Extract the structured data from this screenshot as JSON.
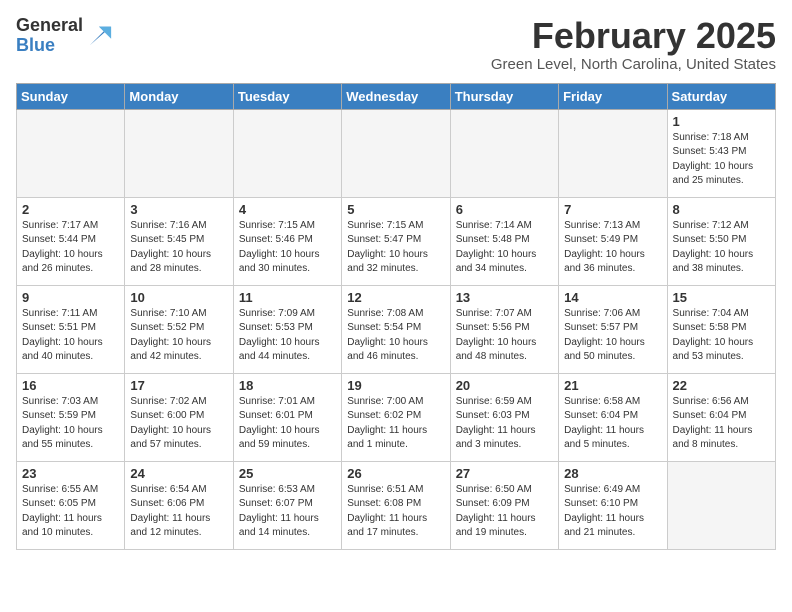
{
  "header": {
    "logo_general": "General",
    "logo_blue": "Blue",
    "title": "February 2025",
    "subtitle": "Green Level, North Carolina, United States"
  },
  "days_of_week": [
    "Sunday",
    "Monday",
    "Tuesday",
    "Wednesday",
    "Thursday",
    "Friday",
    "Saturday"
  ],
  "weeks": [
    [
      {
        "num": "",
        "info": "",
        "empty": true
      },
      {
        "num": "",
        "info": "",
        "empty": true
      },
      {
        "num": "",
        "info": "",
        "empty": true
      },
      {
        "num": "",
        "info": "",
        "empty": true
      },
      {
        "num": "",
        "info": "",
        "empty": true
      },
      {
        "num": "",
        "info": "",
        "empty": true
      },
      {
        "num": "1",
        "info": "Sunrise: 7:18 AM\nSunset: 5:43 PM\nDaylight: 10 hours\nand 25 minutes.",
        "empty": false
      }
    ],
    [
      {
        "num": "2",
        "info": "Sunrise: 7:17 AM\nSunset: 5:44 PM\nDaylight: 10 hours\nand 26 minutes.",
        "empty": false
      },
      {
        "num": "3",
        "info": "Sunrise: 7:16 AM\nSunset: 5:45 PM\nDaylight: 10 hours\nand 28 minutes.",
        "empty": false
      },
      {
        "num": "4",
        "info": "Sunrise: 7:15 AM\nSunset: 5:46 PM\nDaylight: 10 hours\nand 30 minutes.",
        "empty": false
      },
      {
        "num": "5",
        "info": "Sunrise: 7:15 AM\nSunset: 5:47 PM\nDaylight: 10 hours\nand 32 minutes.",
        "empty": false
      },
      {
        "num": "6",
        "info": "Sunrise: 7:14 AM\nSunset: 5:48 PM\nDaylight: 10 hours\nand 34 minutes.",
        "empty": false
      },
      {
        "num": "7",
        "info": "Sunrise: 7:13 AM\nSunset: 5:49 PM\nDaylight: 10 hours\nand 36 minutes.",
        "empty": false
      },
      {
        "num": "8",
        "info": "Sunrise: 7:12 AM\nSunset: 5:50 PM\nDaylight: 10 hours\nand 38 minutes.",
        "empty": false
      }
    ],
    [
      {
        "num": "9",
        "info": "Sunrise: 7:11 AM\nSunset: 5:51 PM\nDaylight: 10 hours\nand 40 minutes.",
        "empty": false
      },
      {
        "num": "10",
        "info": "Sunrise: 7:10 AM\nSunset: 5:52 PM\nDaylight: 10 hours\nand 42 minutes.",
        "empty": false
      },
      {
        "num": "11",
        "info": "Sunrise: 7:09 AM\nSunset: 5:53 PM\nDaylight: 10 hours\nand 44 minutes.",
        "empty": false
      },
      {
        "num": "12",
        "info": "Sunrise: 7:08 AM\nSunset: 5:54 PM\nDaylight: 10 hours\nand 46 minutes.",
        "empty": false
      },
      {
        "num": "13",
        "info": "Sunrise: 7:07 AM\nSunset: 5:56 PM\nDaylight: 10 hours\nand 48 minutes.",
        "empty": false
      },
      {
        "num": "14",
        "info": "Sunrise: 7:06 AM\nSunset: 5:57 PM\nDaylight: 10 hours\nand 50 minutes.",
        "empty": false
      },
      {
        "num": "15",
        "info": "Sunrise: 7:04 AM\nSunset: 5:58 PM\nDaylight: 10 hours\nand 53 minutes.",
        "empty": false
      }
    ],
    [
      {
        "num": "16",
        "info": "Sunrise: 7:03 AM\nSunset: 5:59 PM\nDaylight: 10 hours\nand 55 minutes.",
        "empty": false
      },
      {
        "num": "17",
        "info": "Sunrise: 7:02 AM\nSunset: 6:00 PM\nDaylight: 10 hours\nand 57 minutes.",
        "empty": false
      },
      {
        "num": "18",
        "info": "Sunrise: 7:01 AM\nSunset: 6:01 PM\nDaylight: 10 hours\nand 59 minutes.",
        "empty": false
      },
      {
        "num": "19",
        "info": "Sunrise: 7:00 AM\nSunset: 6:02 PM\nDaylight: 11 hours\nand 1 minute.",
        "empty": false
      },
      {
        "num": "20",
        "info": "Sunrise: 6:59 AM\nSunset: 6:03 PM\nDaylight: 11 hours\nand 3 minutes.",
        "empty": false
      },
      {
        "num": "21",
        "info": "Sunrise: 6:58 AM\nSunset: 6:04 PM\nDaylight: 11 hours\nand 5 minutes.",
        "empty": false
      },
      {
        "num": "22",
        "info": "Sunrise: 6:56 AM\nSunset: 6:04 PM\nDaylight: 11 hours\nand 8 minutes.",
        "empty": false
      }
    ],
    [
      {
        "num": "23",
        "info": "Sunrise: 6:55 AM\nSunset: 6:05 PM\nDaylight: 11 hours\nand 10 minutes.",
        "empty": false
      },
      {
        "num": "24",
        "info": "Sunrise: 6:54 AM\nSunset: 6:06 PM\nDaylight: 11 hours\nand 12 minutes.",
        "empty": false
      },
      {
        "num": "25",
        "info": "Sunrise: 6:53 AM\nSunset: 6:07 PM\nDaylight: 11 hours\nand 14 minutes.",
        "empty": false
      },
      {
        "num": "26",
        "info": "Sunrise: 6:51 AM\nSunset: 6:08 PM\nDaylight: 11 hours\nand 17 minutes.",
        "empty": false
      },
      {
        "num": "27",
        "info": "Sunrise: 6:50 AM\nSunset: 6:09 PM\nDaylight: 11 hours\nand 19 minutes.",
        "empty": false
      },
      {
        "num": "28",
        "info": "Sunrise: 6:49 AM\nSunset: 6:10 PM\nDaylight: 11 hours\nand 21 minutes.",
        "empty": false
      },
      {
        "num": "",
        "info": "",
        "empty": true
      }
    ]
  ]
}
